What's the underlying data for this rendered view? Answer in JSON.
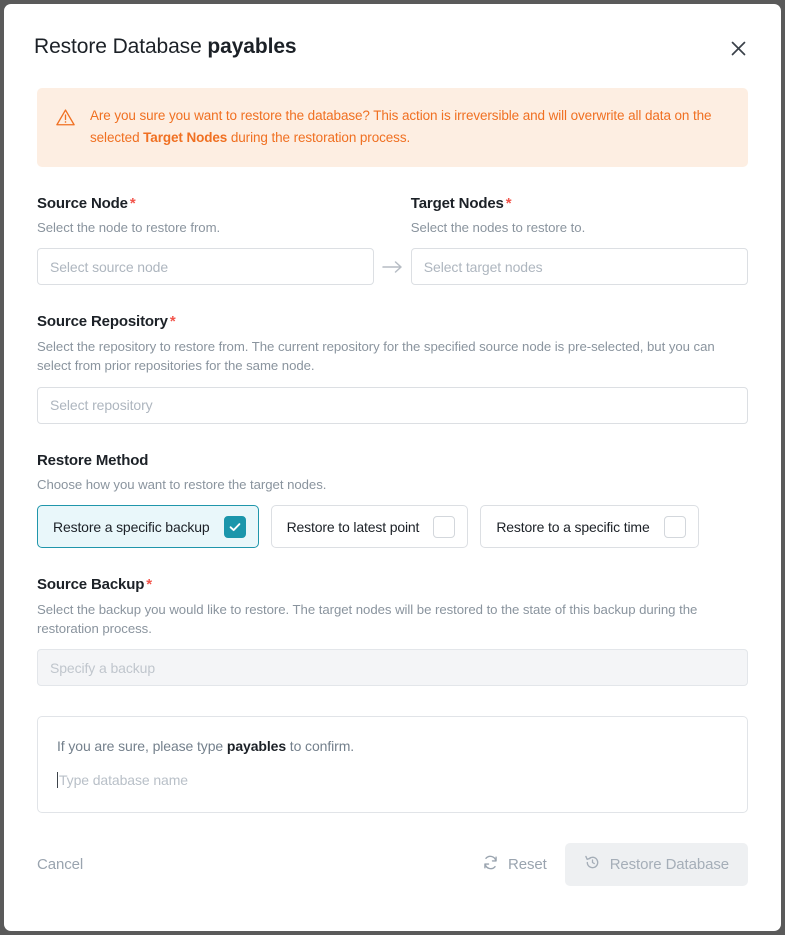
{
  "header": {
    "title_prefix": "Restore Database",
    "database_name": "payables",
    "close_icon": "close-icon"
  },
  "warning": {
    "icon": "warning-triangle-icon",
    "text_part1": "Are you sure you want to restore the database? This action is irreversible and will overwrite all data on the selected ",
    "emphasis": "Target Nodes",
    "text_part2": " during the restoration process.",
    "color": "#f07022",
    "background": "#fdeee2"
  },
  "source_node": {
    "label": "Source Node",
    "required_mark": "*",
    "help": "Select the node to restore from.",
    "placeholder": "Select source node",
    "value": ""
  },
  "target_nodes": {
    "label": "Target Nodes",
    "required_mark": "*",
    "help": "Select the nodes to restore to.",
    "placeholder": "Select target nodes",
    "value": ""
  },
  "arrow_icon": "arrow-right-icon",
  "source_repository": {
    "label": "Source Repository",
    "required_mark": "*",
    "help": "Select the repository to restore from. The current repository for the specified source node is pre-selected, but you can select from prior repositories for the same node.",
    "placeholder": "Select repository",
    "value": ""
  },
  "restore_method": {
    "label": "Restore Method",
    "help": "Choose how you want to restore the target nodes.",
    "accent_color": "#1b96ab",
    "selected_background": "#e9f7fa",
    "options": [
      {
        "label": "Restore a specific backup",
        "selected": true
      },
      {
        "label": "Restore to latest point",
        "selected": false
      },
      {
        "label": "Restore to a specific time",
        "selected": false
      }
    ]
  },
  "source_backup": {
    "label": "Source Backup",
    "required_mark": "*",
    "help": "Select the backup you would like to restore. The target nodes will be restored to the state of this backup during the restoration process.",
    "placeholder": "Specify a backup",
    "value": "",
    "disabled": true
  },
  "confirm": {
    "text_part1": "If you are sure, please type ",
    "emphasis": "payables",
    "text_part2": " to confirm.",
    "placeholder": "Type database name",
    "value": ""
  },
  "footer": {
    "cancel_label": "Cancel",
    "reset_label": "Reset",
    "reset_icon": "refresh-icon",
    "restore_label": "Restore Database",
    "restore_icon": "history-restore-icon",
    "restore_disabled": true
  }
}
